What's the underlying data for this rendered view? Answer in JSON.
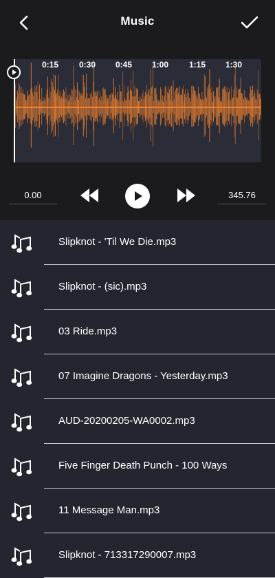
{
  "header": {
    "title": "Music",
    "back_icon": "chevron-left-icon",
    "confirm_icon": "checkmark-icon"
  },
  "timeline": {
    "ticks": [
      "0:15",
      "0:30",
      "0:45",
      "1:00",
      "1:15",
      "1:30"
    ],
    "waveform_color": "#f0822f",
    "waveform_bg": "#2a2c38"
  },
  "player": {
    "start_time": "0.00",
    "end_time": "345.76",
    "rewind_icon": "rewind-icon",
    "play_icon": "play-icon",
    "forward_icon": "fast-forward-icon"
  },
  "songs": [
    {
      "label": "Slipknot - 'Til We Die.mp3"
    },
    {
      "label": "Slipknot - (sic).mp3"
    },
    {
      "label": "03 Ride.mp3"
    },
    {
      "label": "07 Imagine Dragons - Yesterday.mp3"
    },
    {
      "label": "AUD-20200205-WA0002.mp3"
    },
    {
      "label": "Five Finger Death Punch - 100 Ways"
    },
    {
      "label": "11 Message Man.mp3"
    },
    {
      "label": "Slipknot - 713317290007.mp3"
    }
  ],
  "colors": {
    "top_bg": "#1b1b1d",
    "list_bg": "#24262f",
    "accent": "#f0822f"
  }
}
